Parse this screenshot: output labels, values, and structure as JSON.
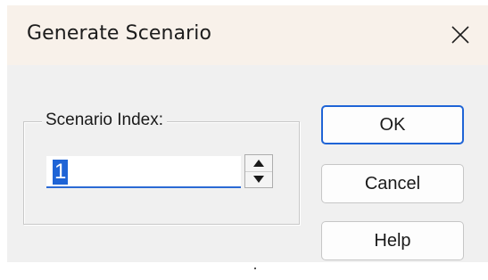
{
  "window": {
    "title": "Generate Scenario",
    "close_icon": "close-icon"
  },
  "group": {
    "label": "Scenario Index:"
  },
  "spinner": {
    "value": "1"
  },
  "buttons": {
    "ok": "OK",
    "cancel": "Cancel",
    "help": "Help"
  },
  "colors": {
    "accent": "#1f64d6",
    "titlebar": "#f8f1ea",
    "dialog_bg": "#f0f0f0"
  }
}
